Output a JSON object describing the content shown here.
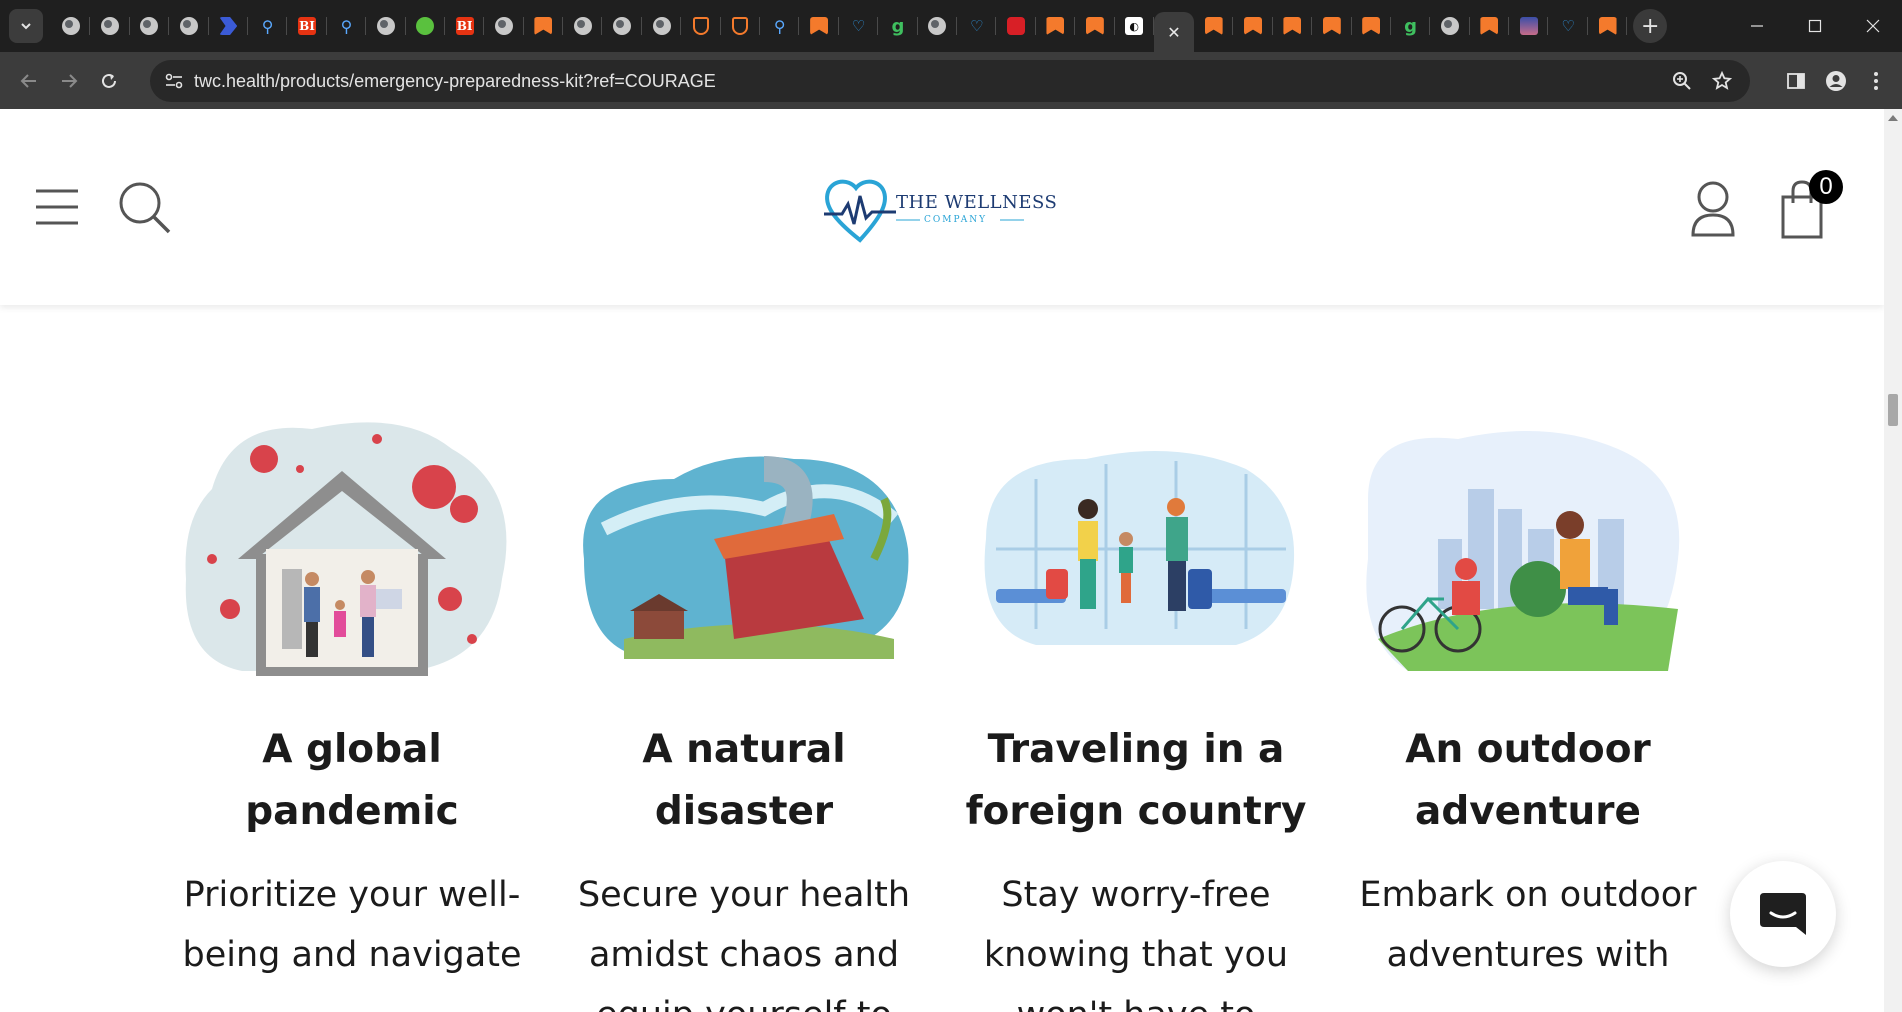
{
  "browser": {
    "tabs": {
      "favicons": [
        "globe",
        "globe",
        "globe",
        "globe",
        "arrow",
        "search",
        "bi",
        "search",
        "globe",
        "play",
        "bi",
        "globe",
        "bookmark",
        "globe",
        "globe",
        "globe",
        "shield",
        "shield",
        "search",
        "bookmark",
        "heart",
        "g",
        "globe",
        "heart",
        "red",
        "bookmark",
        "bookmark",
        "dark"
      ],
      "active_close": "✕",
      "after_favicons": [
        "bookmark",
        "bookmark",
        "bookmark",
        "bookmark",
        "bookmark",
        "g",
        "globe",
        "bookmark",
        "img",
        "heart",
        "bookmark"
      ],
      "new_tab": "+"
    },
    "address_bar": {
      "url": "twc.health/products/emergency-preparedness-kit?ref=COURAGE"
    }
  },
  "site": {
    "logo": {
      "name": "THE WELLNESS",
      "sub": "COMPANY"
    },
    "cart_count": "0"
  },
  "features": [
    {
      "title": "A global pandemic",
      "text": "Prioritize your well-being and navigate"
    },
    {
      "title": "A natural disaster",
      "text": "Secure your health amidst chaos and equip yourself to"
    },
    {
      "title": "Traveling in a foreign country",
      "text": "Stay worry-free knowing that you won't have to"
    },
    {
      "title": "An outdoor adventure",
      "text": "Embark on outdoor adventures with"
    }
  ],
  "colors": {
    "heading": "#1b1b1b",
    "logo_navy": "#1d3b72",
    "logo_blue": "#2aa4d6",
    "badge": "#000000"
  }
}
